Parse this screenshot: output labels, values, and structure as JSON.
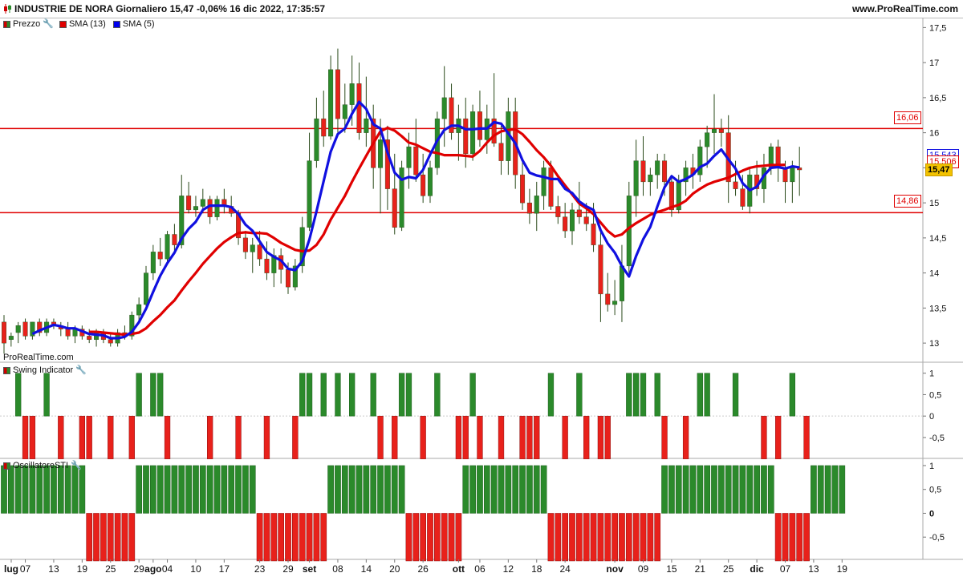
{
  "header": {
    "title": "INDUSTRIE DE NORA Giornaliero 15,47 -0,06% 16 dic 2022, 17:35:57",
    "site": "www.ProRealTime.com"
  },
  "panels": {
    "price": {
      "legend": [
        {
          "label": "Prezzo"
        },
        {
          "label": "SMA (13)",
          "color": "#e00000"
        },
        {
          "label": "SMA (5)",
          "color": "#0000ee"
        }
      ],
      "watermark": "ProRealTime.com"
    },
    "swing": {
      "legend": "Swing Indicator"
    },
    "osc": {
      "legend": "OscillatoreSTI"
    }
  },
  "levels": {
    "upper": {
      "value": 16.06,
      "label": "16,06"
    },
    "lower": {
      "value": 14.86,
      "label": "14,86"
    },
    "sma13_label": "15,543",
    "sma5_label": "15,506",
    "last_label": "15,47"
  },
  "colors": {
    "up": "#2b8a2b",
    "down": "#e8211b",
    "sma13": "#e00000",
    "sma5": "#1010e0",
    "level": "#e00000"
  },
  "chart_data": {
    "type": "bar",
    "price": {
      "ylim": [
        12.75,
        17.55
      ],
      "yticks": [
        "13",
        "13,5",
        "14",
        "14,5",
        "15",
        "15,5",
        "16",
        "16,5",
        "17",
        "17,5"
      ],
      "ytick_values": [
        13,
        13.5,
        14,
        14.5,
        15,
        15.5,
        16,
        16.5,
        17,
        17.5
      ],
      "ohlc": [
        [
          13.3,
          13.4,
          12.85,
          13.0
        ],
        [
          13.05,
          13.15,
          12.95,
          13.1
        ],
        [
          13.15,
          13.3,
          13.0,
          13.25
        ],
        [
          13.3,
          13.35,
          13.05,
          13.1
        ],
        [
          13.1,
          13.3,
          13.05,
          13.3
        ],
        [
          13.3,
          13.35,
          13.1,
          13.15
        ],
        [
          13.15,
          13.35,
          13.1,
          13.3
        ],
        [
          13.3,
          13.35,
          13.2,
          13.25
        ],
        [
          13.25,
          13.3,
          13.1,
          13.2
        ],
        [
          13.2,
          13.3,
          13.05,
          13.1
        ],
        [
          13.1,
          13.25,
          13.0,
          13.2
        ],
        [
          13.2,
          13.25,
          13.05,
          13.1
        ],
        [
          13.1,
          13.2,
          13.0,
          13.05
        ],
        [
          13.05,
          13.2,
          12.95,
          13.15
        ],
        [
          13.15,
          13.2,
          13.0,
          13.05
        ],
        [
          13.05,
          13.15,
          12.95,
          13.0
        ],
        [
          13.0,
          13.2,
          12.95,
          13.15
        ],
        [
          13.15,
          13.25,
          13.05,
          13.1
        ],
        [
          13.1,
          13.45,
          13.05,
          13.4
        ],
        [
          13.4,
          13.65,
          13.3,
          13.55
        ],
        [
          13.55,
          14.1,
          13.5,
          14.0
        ],
        [
          14.0,
          14.4,
          13.9,
          14.3
        ],
        [
          14.3,
          14.5,
          14.1,
          14.2
        ],
        [
          14.2,
          14.6,
          14.15,
          14.55
        ],
        [
          14.55,
          14.7,
          14.3,
          14.4
        ],
        [
          14.4,
          15.4,
          14.35,
          15.1
        ],
        [
          15.1,
          15.3,
          14.85,
          14.9
        ],
        [
          14.9,
          15.1,
          14.8,
          14.95
        ],
        [
          14.95,
          15.2,
          14.85,
          15.05
        ],
        [
          15.05,
          15.1,
          14.7,
          14.8
        ],
        [
          14.8,
          15.1,
          14.75,
          15.05
        ],
        [
          15.05,
          15.2,
          14.85,
          14.95
        ],
        [
          14.95,
          15.1,
          14.8,
          14.85
        ],
        [
          14.85,
          14.9,
          14.4,
          14.5
        ],
        [
          14.5,
          14.6,
          14.2,
          14.3
        ],
        [
          14.3,
          14.5,
          14.0,
          14.4
        ],
        [
          14.4,
          14.6,
          14.1,
          14.2
        ],
        [
          14.2,
          14.45,
          13.9,
          14.0
        ],
        [
          14.0,
          14.35,
          13.8,
          14.25
        ],
        [
          14.25,
          14.35,
          13.85,
          14.05
        ],
        [
          14.05,
          14.15,
          13.7,
          13.8
        ],
        [
          13.8,
          14.2,
          13.75,
          14.1
        ],
        [
          14.1,
          14.8,
          14.0,
          14.65
        ],
        [
          14.65,
          16.0,
          14.6,
          15.6
        ],
        [
          15.6,
          16.5,
          15.5,
          16.2
        ],
        [
          16.2,
          16.6,
          15.8,
          15.95
        ],
        [
          15.95,
          17.1,
          15.9,
          16.9
        ],
        [
          16.9,
          17.2,
          16.0,
          16.2
        ],
        [
          16.2,
          16.7,
          16.0,
          16.4
        ],
        [
          16.4,
          17.1,
          16.1,
          16.7
        ],
        [
          16.7,
          17.0,
          15.9,
          16.0
        ],
        [
          16.0,
          16.8,
          15.8,
          16.2
        ],
        [
          16.2,
          16.4,
          15.2,
          15.5
        ],
        [
          15.5,
          16.2,
          14.85,
          15.9
        ],
        [
          15.9,
          16.1,
          14.9,
          15.2
        ],
        [
          15.2,
          15.7,
          14.55,
          14.65
        ],
        [
          14.65,
          15.6,
          14.6,
          15.5
        ],
        [
          15.5,
          16.0,
          15.2,
          15.8
        ],
        [
          15.8,
          16.2,
          15.3,
          15.4
        ],
        [
          15.4,
          15.7,
          15.0,
          15.1
        ],
        [
          15.1,
          15.6,
          15.0,
          15.5
        ],
        [
          15.5,
          16.3,
          15.4,
          16.2
        ],
        [
          16.2,
          16.95,
          15.8,
          16.5
        ],
        [
          16.5,
          16.7,
          15.9,
          16.0
        ],
        [
          16.0,
          16.4,
          15.6,
          16.2
        ],
        [
          16.2,
          16.5,
          15.5,
          15.7
        ],
        [
          15.7,
          16.4,
          15.6,
          16.3
        ],
        [
          16.3,
          16.6,
          15.8,
          15.9
        ],
        [
          15.9,
          16.4,
          15.7,
          16.2
        ],
        [
          16.2,
          16.85,
          15.8,
          15.85
        ],
        [
          15.85,
          16.1,
          15.4,
          15.6
        ],
        [
          15.6,
          16.5,
          15.4,
          16.3
        ],
        [
          16.3,
          16.5,
          15.2,
          15.4
        ],
        [
          15.4,
          15.6,
          14.9,
          15.0
        ],
        [
          15.0,
          15.2,
          14.7,
          14.85
        ],
        [
          14.85,
          15.3,
          14.6,
          15.1
        ],
        [
          15.1,
          15.6,
          14.9,
          15.5
        ],
        [
          15.5,
          15.6,
          14.9,
          14.95
        ],
        [
          14.95,
          15.1,
          14.7,
          14.8
        ],
        [
          14.8,
          15.0,
          14.5,
          14.6
        ],
        [
          14.6,
          15.0,
          14.4,
          14.9
        ],
        [
          14.9,
          15.3,
          14.7,
          14.8
        ],
        [
          14.8,
          15.0,
          14.6,
          14.7
        ],
        [
          14.7,
          15.0,
          14.3,
          14.4
        ],
        [
          14.4,
          14.6,
          13.3,
          13.7
        ],
        [
          13.7,
          14.0,
          13.45,
          13.55
        ],
        [
          13.55,
          13.9,
          13.4,
          13.6
        ],
        [
          13.6,
          14.4,
          13.3,
          14.1
        ],
        [
          14.1,
          15.3,
          14.0,
          15.1
        ],
        [
          15.1,
          15.9,
          14.8,
          15.6
        ],
        [
          15.6,
          15.95,
          15.1,
          15.3
        ],
        [
          15.3,
          15.5,
          15.1,
          15.4
        ],
        [
          15.4,
          15.7,
          15.2,
          15.6
        ],
        [
          15.6,
          15.7,
          15.1,
          15.3
        ],
        [
          15.3,
          15.4,
          14.8,
          14.9
        ],
        [
          14.9,
          15.4,
          14.85,
          15.3
        ],
        [
          15.3,
          15.6,
          15.1,
          15.5
        ],
        [
          15.5,
          15.7,
          15.2,
          15.4
        ],
        [
          15.4,
          15.9,
          15.3,
          15.8
        ],
        [
          15.8,
          16.1,
          15.5,
          16.0
        ],
        [
          16.0,
          16.55,
          15.7,
          16.05
        ],
        [
          16.05,
          16.2,
          15.8,
          16.0
        ],
        [
          16.0,
          16.25,
          15.0,
          15.3
        ],
        [
          15.3,
          15.6,
          15.1,
          15.2
        ],
        [
          15.2,
          15.4,
          14.9,
          14.95
        ],
        [
          14.95,
          15.5,
          14.85,
          15.4
        ],
        [
          15.4,
          15.6,
          15.1,
          15.2
        ],
        [
          15.2,
          15.7,
          15.0,
          15.5
        ],
        [
          15.5,
          15.85,
          15.4,
          15.8
        ],
        [
          15.8,
          15.9,
          15.3,
          15.5
        ],
        [
          15.5,
          15.6,
          15.0,
          15.3
        ],
        [
          15.3,
          15.6,
          15.0,
          15.5
        ],
        [
          15.5,
          15.8,
          15.1,
          15.47
        ]
      ],
      "sma13": [
        null,
        null,
        null,
        null,
        null,
        null,
        null,
        null,
        null,
        null,
        null,
        null,
        13.16,
        13.16,
        13.15,
        13.14,
        13.13,
        13.12,
        13.13,
        13.15,
        13.21,
        13.31,
        13.4,
        13.51,
        13.61,
        13.75,
        13.88,
        14.0,
        14.13,
        14.24,
        14.35,
        14.44,
        14.51,
        14.57,
        14.58,
        14.57,
        14.57,
        14.56,
        14.5,
        14.43,
        14.38,
        14.33,
        14.31,
        14.32,
        14.4,
        14.55,
        14.76,
        14.93,
        15.1,
        15.3,
        15.49,
        15.67,
        15.85,
        16.02,
        16.07,
        16.03,
        15.95,
        15.86,
        15.83,
        15.78,
        15.73,
        15.71,
        15.68,
        15.68,
        15.68,
        15.67,
        15.66,
        15.74,
        15.86,
        15.96,
        16.02,
        16.04,
        16.05,
        15.98,
        15.87,
        15.75,
        15.65,
        15.53,
        15.38,
        15.25,
        15.12,
        14.99,
        14.92,
        14.84,
        14.72,
        14.6,
        14.52,
        14.55,
        14.64,
        14.71,
        14.77,
        14.83,
        14.87,
        14.9,
        14.94,
        14.97,
        15.03,
        15.13,
        15.2,
        15.26,
        15.3,
        15.33,
        15.36,
        15.41,
        15.46,
        15.5,
        15.52,
        15.53,
        15.54,
        15.54,
        15.543
      ],
      "sma5": [
        null,
        null,
        null,
        null,
        13.13,
        13.18,
        13.22,
        13.26,
        13.24,
        13.21,
        13.21,
        13.17,
        13.13,
        13.12,
        13.11,
        13.07,
        13.07,
        13.09,
        13.16,
        13.3,
        13.49,
        13.73,
        13.96,
        14.14,
        14.29,
        14.49,
        14.63,
        14.73,
        14.9,
        14.96,
        14.96,
        14.96,
        14.94,
        14.84,
        14.69,
        14.6,
        14.45,
        14.3,
        14.23,
        14.18,
        14.06,
        14.04,
        14.17,
        14.48,
        14.88,
        15.31,
        15.73,
        15.98,
        16.06,
        16.27,
        16.44,
        16.34,
        16.12,
        16.06,
        15.72,
        15.43,
        15.33,
        15.37,
        15.35,
        15.47,
        15.69,
        15.89,
        16.04,
        16.1,
        16.1,
        16.05,
        16.05,
        16.06,
        16.06,
        16.15,
        16.13,
        15.99,
        15.85,
        15.61,
        15.43,
        15.39,
        15.37,
        15.34,
        15.34,
        15.2,
        15.14,
        15.02,
        14.95,
        14.9,
        14.61,
        14.42,
        14.29,
        14.1,
        13.95,
        14.24,
        14.48,
        14.66,
        14.95,
        15.22,
        15.38,
        15.3,
        15.34,
        15.4,
        15.51,
        15.56,
        15.67,
        15.76,
        15.62,
        15.49,
        15.28,
        15.18,
        15.23,
        15.39,
        15.5,
        15.51,
        15.49,
        15.52,
        15.506
      ]
    },
    "swing": {
      "ylim": [
        -0.95,
        1.2
      ],
      "yticks": [
        "1",
        "0,5",
        "0",
        "-0,5"
      ],
      "ytick_values": [
        1,
        0.5,
        0,
        -0.5
      ],
      "up_index": [
        2,
        6,
        19,
        21,
        22,
        42,
        43,
        45,
        47,
        49,
        52,
        56,
        57,
        61,
        66,
        77,
        81,
        88,
        89,
        90,
        92,
        98,
        99,
        103,
        111
      ],
      "down_index": [
        3,
        4,
        8,
        11,
        12,
        15,
        18,
        23,
        29,
        33,
        37,
        41,
        53,
        55,
        59,
        64,
        65,
        67,
        70,
        73,
        74,
        75,
        79,
        82,
        84,
        85,
        93,
        96,
        107,
        109,
        113
      ]
    },
    "osc": {
      "ylim": [
        -0.95,
        1.1
      ],
      "yticks": [
        "1",
        "0,5",
        "0",
        "-0,5"
      ],
      "ytick_values": [
        1,
        0.5,
        0,
        -0.5
      ],
      "signs": [
        1,
        1,
        1,
        1,
        1,
        1,
        1,
        1,
        1,
        1,
        1,
        1,
        -1,
        -1,
        -1,
        -1,
        -1,
        -1,
        -1,
        1,
        1,
        1,
        1,
        1,
        1,
        1,
        1,
        1,
        1,
        1,
        1,
        1,
        1,
        1,
        1,
        1,
        -1,
        -1,
        -1,
        -1,
        -1,
        -1,
        -1,
        -1,
        -1,
        -1,
        1,
        1,
        1,
        1,
        1,
        1,
        1,
        1,
        1,
        1,
        1,
        -1,
        -1,
        -1,
        -1,
        -1,
        -1,
        -1,
        -1,
        1,
        1,
        1,
        1,
        1,
        1,
        1,
        1,
        1,
        1,
        1,
        1,
        -1,
        -1,
        -1,
        -1,
        -1,
        -1,
        -1,
        -1,
        -1,
        -1,
        -1,
        -1,
        -1,
        -1,
        -1,
        -1,
        1,
        1,
        1,
        1,
        1,
        1,
        1,
        1,
        1,
        1,
        1,
        1,
        1,
        1,
        1,
        1,
        -1,
        -1,
        -1,
        -1,
        -1,
        1,
        1,
        1,
        1,
        1
      ]
    },
    "x_axis": {
      "labels": [
        {
          "i": -1,
          "text": "lug",
          "major": true
        },
        {
          "i": 3,
          "text": "07"
        },
        {
          "i": 7,
          "text": "13"
        },
        {
          "i": 11,
          "text": "19"
        },
        {
          "i": 15,
          "text": "25"
        },
        {
          "i": 19,
          "text": "29"
        },
        {
          "i": 21,
          "text": "ago",
          "major": true
        },
        {
          "i": 23,
          "text": "04"
        },
        {
          "i": 27,
          "text": "10"
        },
        {
          "i": 31,
          "text": "17"
        },
        {
          "i": 36,
          "text": "23"
        },
        {
          "i": 40,
          "text": "29"
        },
        {
          "i": 43,
          "text": "set",
          "major": true
        },
        {
          "i": 47,
          "text": "08"
        },
        {
          "i": 51,
          "text": "14"
        },
        {
          "i": 55,
          "text": "20"
        },
        {
          "i": 59,
          "text": "26"
        },
        {
          "i": 64,
          "text": "ott",
          "major": true
        },
        {
          "i": 67,
          "text": "06"
        },
        {
          "i": 71,
          "text": "12"
        },
        {
          "i": 75,
          "text": "18"
        },
        {
          "i": 79,
          "text": "24"
        },
        {
          "i": 86,
          "text": "nov",
          "major": true
        },
        {
          "i": 90,
          "text": "09"
        },
        {
          "i": 94,
          "text": "15"
        },
        {
          "i": 98,
          "text": "21"
        },
        {
          "i": 102,
          "text": "25"
        },
        {
          "i": 106,
          "text": "dic",
          "major": true
        },
        {
          "i": 110,
          "text": "07"
        },
        {
          "i": 114,
          "text": "13"
        },
        {
          "i": 118,
          "text": "19"
        }
      ]
    }
  }
}
